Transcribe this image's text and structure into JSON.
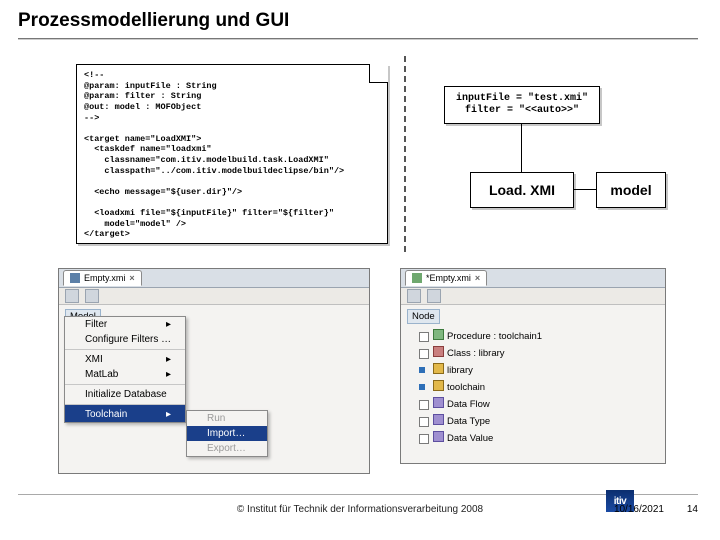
{
  "title": "Prozessmodellierung und GUI",
  "code_lines": "<!--\n@param: inputFile : String\n@param: filter : String\n@out: model : MOFObject\n-->\n\n<target name=\"LoadXMI\">\n  <taskdef name=\"loadxmi\"\n    classname=\"com.itiv.modelbuild.task.LoadXMI\"\n    classpath=\"../com.itiv.modelbuildeclipse/bin\"/>\n\n  <echo message=\"${user.dir}\"/>\n\n  <loadxmi file=\"${inputFile}\" filter=\"${filter}\"\n    model=\"model\" />\n</target>",
  "params": {
    "line1": "inputFile = \"test.xmi\"",
    "line2": "filter = \"<<auto>>\""
  },
  "node": {
    "label": "Load. XMI",
    "out": "model"
  },
  "left_shot": {
    "tab": "Empty.xmi",
    "root": "Model",
    "menu1": [
      "Filter",
      "Configure Filters …",
      "",
      "XMI",
      "MatLab",
      "",
      "Initialize Database",
      "",
      "Toolchain"
    ],
    "menu1_selected": "Toolchain",
    "menu2": [
      "Run",
      "Import…",
      "Export…"
    ],
    "menu2_selected": "Import…",
    "menu2_disabled": [
      "Run",
      "Export…"
    ]
  },
  "right_shot": {
    "tab": "*Empty.xmi",
    "root": "Node",
    "items": [
      {
        "text": "Procedure : toolchain1",
        "cls": "b"
      },
      {
        "text": "Class : library",
        "cls": "r"
      },
      {
        "text": "library",
        "cls": "cube"
      },
      {
        "text": "toolchain",
        "cls": "cube"
      },
      {
        "text": "Data Flow",
        "cls": "p"
      },
      {
        "text": "Data Type",
        "cls": "p"
      },
      {
        "text": "Data Value",
        "cls": "p"
      }
    ]
  },
  "footer": {
    "copyright": "© Institut für Technik der Informationsverarbeitung  2008",
    "date": "10/16/2021",
    "page": "14",
    "logo": "itiv"
  },
  "chart_data": {
    "type": "table",
    "title": "Prozessmodellierung und GUI",
    "note": "Slide shows an Ant/XML target definition feeding a LoadXMI task, a small dataflow diagram (inputFile/filter → Load.XMI → model), and two Eclipse-style tree screenshots with a Toolchain→Import… context menu.",
    "series": []
  }
}
